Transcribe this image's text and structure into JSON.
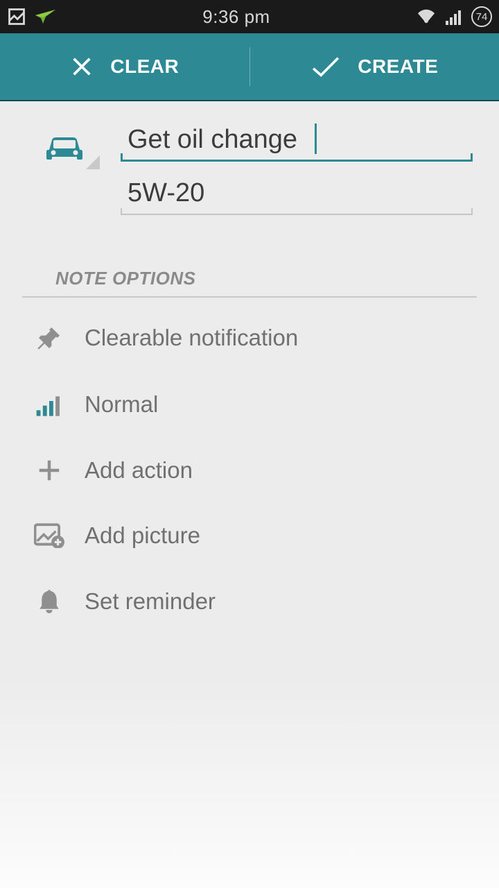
{
  "status": {
    "time": "9:36 pm",
    "battery": "74"
  },
  "actions": {
    "clear": "CLEAR",
    "create": "CREATE"
  },
  "note": {
    "title": "Get oil change",
    "subtitle": "5W-20"
  },
  "section_header": "NOTE OPTIONS",
  "options": {
    "clearable": "Clearable notification",
    "priority": "Normal",
    "add_action": "Add action",
    "add_picture": "Add picture",
    "set_reminder": "Set reminder"
  }
}
